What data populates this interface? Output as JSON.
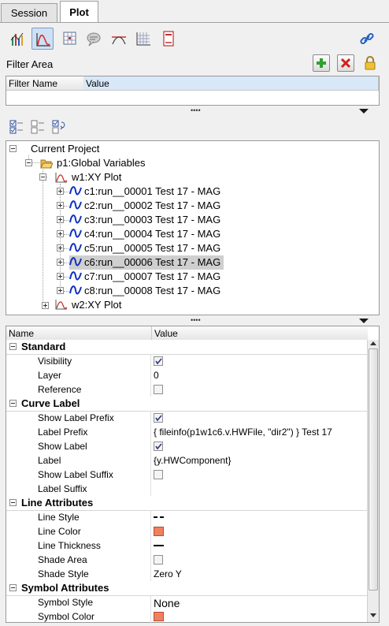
{
  "tabs": [
    {
      "label": "Session",
      "active": false
    },
    {
      "label": "Plot",
      "active": true
    }
  ],
  "toolbar": {
    "icons": [
      "bar-chart-icon",
      "xy-curve-icon",
      "table-grid-icon",
      "note-icon",
      "datum-line-icon",
      "grid-lines-icon",
      "page-icon"
    ],
    "right_icon": "link-icon"
  },
  "filter": {
    "title": "Filter Area",
    "columns": [
      "Filter Name",
      "Value"
    ]
  },
  "tree": {
    "root": "Current Project",
    "folder": "p1:Global Variables",
    "plot1": "w1:XY Plot",
    "curves": [
      "c1:run__00001 Test 17 - MAG",
      "c2:run__00002 Test 17 - MAG",
      "c3:run__00003 Test 17 - MAG",
      "c4:run__00004 Test 17 - MAG",
      "c5:run__00005 Test 17 - MAG",
      "c6:run__00006 Test 17 - MAG",
      "c7:run__00007 Test 17 - MAG",
      "c8:run__00008 Test 17 - MAG"
    ],
    "selected_index": 5,
    "plot2": "w2:XY Plot"
  },
  "properties": {
    "columns": [
      "Name",
      "Value"
    ],
    "sections": {
      "standard": "Standard",
      "curve_label": "Curve Label",
      "line_attributes": "Line Attributes",
      "symbol_attributes": "Symbol Attributes"
    },
    "visibility": {
      "name": "Visibility",
      "checked": true
    },
    "layer": {
      "name": "Layer",
      "value": "0"
    },
    "reference": {
      "name": "Reference",
      "checked": false
    },
    "show_label_prefix": {
      "name": "Show Label Prefix",
      "checked": true
    },
    "label_prefix": {
      "name": "Label Prefix",
      "value": "{ fileinfo(p1w1c6.v.HWFile, \"dir2\") } Test 17"
    },
    "show_label": {
      "name": "Show Label",
      "checked": true
    },
    "label": {
      "name": "Label",
      "value": "{y.HWComponent}"
    },
    "show_label_suffix": {
      "name": "Show Label Suffix",
      "checked": false
    },
    "label_suffix": {
      "name": "Label Suffix",
      "value": ""
    },
    "line_style": {
      "name": "Line Style"
    },
    "line_color": {
      "name": "Line Color",
      "color": "#f08060"
    },
    "line_thickness": {
      "name": "Line Thickness"
    },
    "shade_area": {
      "name": "Shade Area",
      "checked": false
    },
    "shade_style": {
      "name": "Shade Style",
      "value": "Zero Y"
    },
    "symbol_style": {
      "name": "Symbol Style",
      "value": "None"
    },
    "symbol_color": {
      "name": "Symbol Color",
      "color": "#f08060"
    }
  }
}
